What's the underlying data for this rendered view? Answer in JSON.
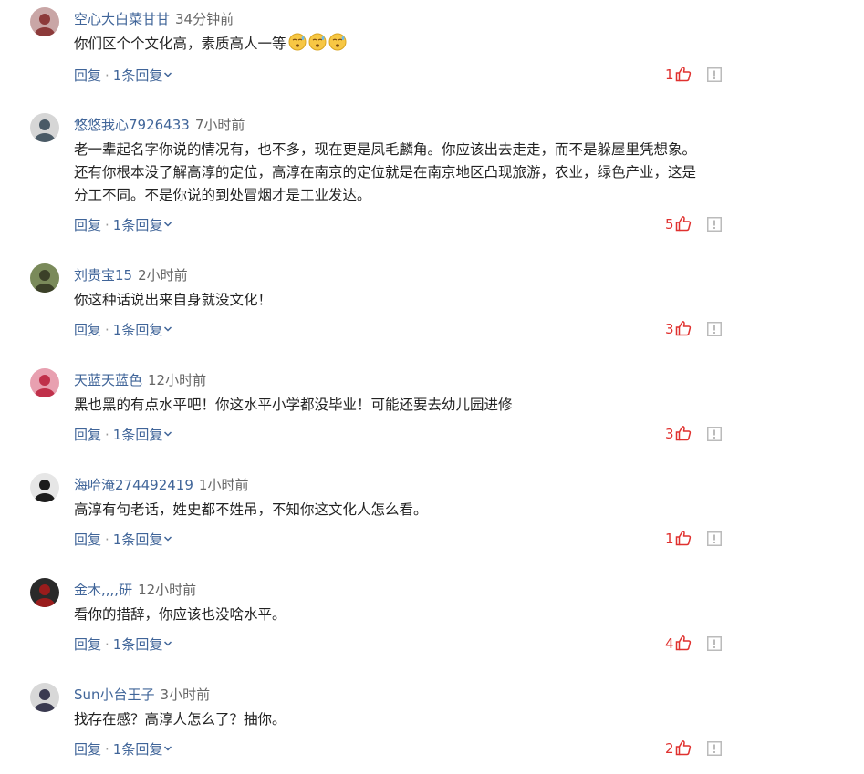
{
  "comments": [
    {
      "username": "空心大白菜甘甘",
      "time": "34分钟前",
      "lines": [
        "你们区个个文化高，素质高人一等"
      ],
      "emoji_count": 3,
      "reply_label": "回复",
      "replies_label": "1条回复",
      "likes": "1",
      "avatar_colors": [
        "#c9a6a6",
        "#8c3a3a"
      ]
    },
    {
      "username": "悠悠我心7926433",
      "time": "7小时前",
      "lines": [
        "老一辈起名字你说的情况有，也不多，现在更是凤毛麟角。你应该出去走走，而不是躲屋里凭想象。",
        "还有你根本没了解高淳的定位，高淳在南京的定位就是在南京地区凸现旅游，农业，绿色产业，这是",
        "分工不同。不是你说的到处冒烟才是工业发达。"
      ],
      "emoji_count": 0,
      "reply_label": "回复",
      "replies_label": "1条回复",
      "likes": "5",
      "avatar_colors": [
        "#d6d6d6",
        "#4a5a66"
      ]
    },
    {
      "username": "刘贵宝15",
      "time": "2小时前",
      "lines": [
        "你这种话说出来自身就没文化！"
      ],
      "emoji_count": 0,
      "reply_label": "回复",
      "replies_label": "1条回复",
      "likes": "3",
      "avatar_colors": [
        "#7a8a5a",
        "#3b4028"
      ]
    },
    {
      "username": "天蓝天蓝色",
      "time": "12小时前",
      "lines": [
        "黑也黑的有点水平吧！你这水平小学都没毕业！可能还要去幼儿园进修"
      ],
      "emoji_count": 0,
      "reply_label": "回复",
      "replies_label": "1条回复",
      "likes": "3",
      "avatar_colors": [
        "#e8a0b0",
        "#c0304a"
      ]
    },
    {
      "username": "海哈淹274492419",
      "time": "1小时前",
      "lines": [
        "高淳有句老话，姓史都不姓吊，不知你这文化人怎么看。"
      ],
      "emoji_count": 0,
      "reply_label": "回复",
      "replies_label": "1条回复",
      "likes": "1",
      "avatar_colors": [
        "#e6e6e6",
        "#1c1c1c"
      ]
    },
    {
      "username": "金木,,,,研",
      "time": "12小时前",
      "lines": [
        "看你的措辞，你应该也没啥水平。"
      ],
      "emoji_count": 0,
      "reply_label": "回复",
      "replies_label": "1条回复",
      "likes": "4",
      "avatar_colors": [
        "#2a2a2a",
        "#9a1c1c"
      ]
    },
    {
      "username": "Sun小台王子",
      "time": "3小时前",
      "lines": [
        "找存在感？高淳人怎么了？抽你。"
      ],
      "emoji_count": 0,
      "reply_label": "回复",
      "replies_label": "1条回复",
      "likes": "2",
      "avatar_colors": [
        "#d8d8d8",
        "#3a3a50"
      ]
    }
  ],
  "colors": {
    "username": "#406599",
    "time": "#666666",
    "body_text": "#222222",
    "action": "#406599",
    "like": "#e0312f",
    "report": "#bbbbbb"
  },
  "icons": {
    "chevron": "chevron-down-icon",
    "like": "thumbs-up-icon",
    "report": "report-icon",
    "emoji": "emoji-icon"
  }
}
